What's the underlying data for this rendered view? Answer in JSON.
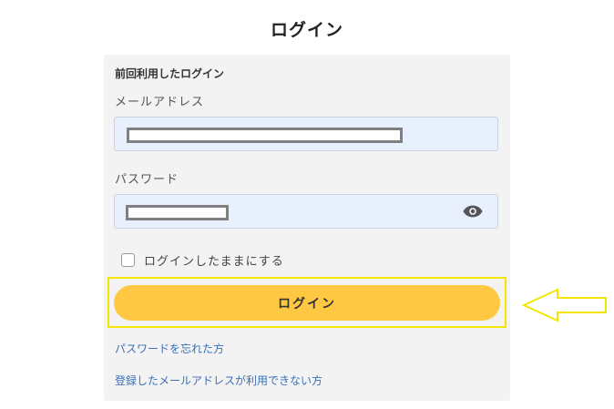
{
  "page": {
    "title": "ログイン"
  },
  "form": {
    "section_title": "前回利用したログイン",
    "email_label": "メールアドレス",
    "password_label": "パスワード",
    "remember_label": "ログインしたままにする",
    "remember_checked": false,
    "login_button_label": "ログイン",
    "forgot_password_link": "パスワードを忘れた方",
    "email_unavailable_link": "登録したメールアドレスが利用できない方"
  },
  "icons": {
    "password_toggle": "eye-icon",
    "callout": "arrow-left-icon"
  },
  "colors": {
    "login_button": "#ffc843",
    "highlight_border": "#f5e600",
    "input_background": "#e8f0fe",
    "link": "#3b6fb6",
    "panel_background": "#f3f3f3"
  }
}
